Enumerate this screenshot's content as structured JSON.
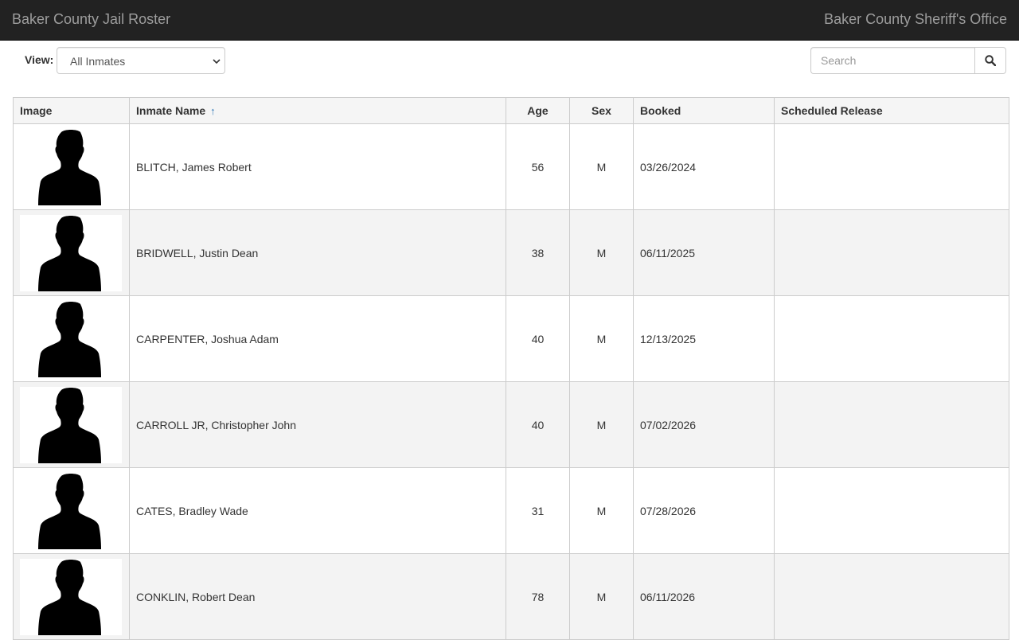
{
  "navbar": {
    "title": "Baker County Jail Roster",
    "org": "Baker County Sheriff's Office"
  },
  "filter": {
    "view_label": "View:",
    "view_selected": "All Inmates"
  },
  "search": {
    "placeholder": "Search",
    "icon": "search-icon"
  },
  "table": {
    "headers": {
      "image": "Image",
      "name": "Inmate Name",
      "sort_indicator": "↑",
      "age": "Age",
      "sex": "Sex",
      "booked": "Booked",
      "release": "Scheduled Release"
    },
    "rows": [
      {
        "name": "BLITCH, James Robert",
        "age": "56",
        "sex": "M",
        "booked": "03/26/2024",
        "release": ""
      },
      {
        "name": "BRIDWELL, Justin Dean",
        "age": "38",
        "sex": "M",
        "booked": "06/11/2025",
        "release": ""
      },
      {
        "name": "CARPENTER, Joshua Adam",
        "age": "40",
        "sex": "M",
        "booked": "12/13/2025",
        "release": ""
      },
      {
        "name": "CARROLL JR, Christopher John",
        "age": "40",
        "sex": "M",
        "booked": "07/02/2026",
        "release": ""
      },
      {
        "name": "CATES, Bradley Wade",
        "age": "31",
        "sex": "M",
        "booked": "07/28/2026",
        "release": ""
      },
      {
        "name": "CONKLIN, Robert Dean",
        "age": "78",
        "sex": "M",
        "booked": "06/11/2026",
        "release": ""
      }
    ],
    "photo_icon": "person-silhouette-icon"
  },
  "colors": {
    "navbar_bg": "#222222",
    "navbar_text": "#9d9d9d",
    "sort_accent": "#337ab7",
    "row_alt": "#f3f3f3"
  }
}
